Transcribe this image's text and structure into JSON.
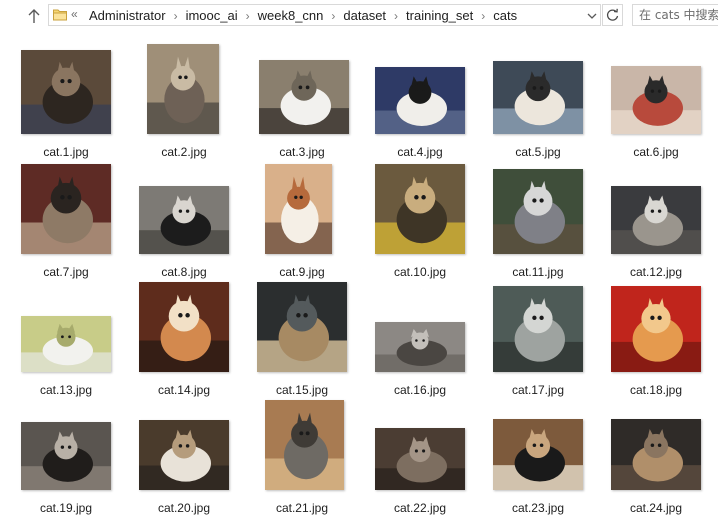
{
  "addressbar": {
    "overflow": "«",
    "breadcrumbs": [
      "Administrator",
      "imooc_ai",
      "week8_cnn",
      "dataset",
      "training_set",
      "cats"
    ],
    "separator": "›"
  },
  "search": {
    "placeholder": "在 cats 中搜索"
  },
  "files": [
    {
      "name": "cat.1.jpg",
      "palette": [
        "#5b4a3a",
        "#2d2620",
        "#8a7560",
        "#3a3f52"
      ]
    },
    {
      "name": "cat.2.jpg",
      "palette": [
        "#9f8f78",
        "#6e6156",
        "#c9bba4",
        "#4f4a43"
      ]
    },
    {
      "name": "cat.3.jpg",
      "palette": [
        "#8a7f6e",
        "#f2f1ee",
        "#6e6659",
        "#3b3631"
      ]
    },
    {
      "name": "cat.4.jpg",
      "palette": [
        "#2e3a66",
        "#f0eeea",
        "#1a1a1a",
        "#5c6b8e"
      ]
    },
    {
      "name": "cat.5.jpg",
      "palette": [
        "#3e4a57",
        "#ece6dc",
        "#2b2b2b",
        "#8fa3b8"
      ]
    },
    {
      "name": "cat.6.jpg",
      "palette": [
        "#c9b6a8",
        "#b84a3c",
        "#2a2a2a",
        "#e8d9cb"
      ]
    },
    {
      "name": "cat.7.jpg",
      "palette": [
        "#5e2b25",
        "#8e7a66",
        "#2a2420",
        "#b59e86"
      ]
    },
    {
      "name": "cat.8.jpg",
      "palette": [
        "#7d7a75",
        "#1c1c1c",
        "#d9d5cf",
        "#4a4844"
      ]
    },
    {
      "name": "cat.9.jpg",
      "palette": [
        "#d9b08a",
        "#f5efe6",
        "#b66a3c",
        "#6e5140"
      ]
    },
    {
      "name": "cat.10.jpg",
      "palette": [
        "#6b5a3e",
        "#3e3526",
        "#c9ad7e",
        "#d3b335"
      ]
    },
    {
      "name": "cat.11.jpg",
      "palette": [
        "#3f4e3a",
        "#7f8087",
        "#d6d6d6",
        "#5e5140"
      ]
    },
    {
      "name": "cat.12.jpg",
      "palette": [
        "#3a3b3e",
        "#9a958d",
        "#d9d7d2",
        "#565450"
      ]
    },
    {
      "name": "cat.13.jpg",
      "palette": [
        "#c8cc88",
        "#f2f2ee",
        "#a7ab6c",
        "#e1e3d6"
      ]
    },
    {
      "name": "cat.14.jpg",
      "palette": [
        "#5e2c1c",
        "#d3894e",
        "#f2e0c6",
        "#2b1b14"
      ]
    },
    {
      "name": "cat.15.jpg",
      "palette": [
        "#2b2e2f",
        "#a78a63",
        "#545a5c",
        "#d8c29b"
      ]
    },
    {
      "name": "cat.16.jpg",
      "palette": [
        "#8c8884",
        "#4a4642",
        "#c3bfba",
        "#6a6661"
      ]
    },
    {
      "name": "cat.17.jpg",
      "palette": [
        "#4e5b57",
        "#9ea3a0",
        "#d4d6d3",
        "#2f3432"
      ]
    },
    {
      "name": "cat.18.jpg",
      "palette": [
        "#c0251c",
        "#e59a4e",
        "#f2c88c",
        "#7a1912"
      ]
    },
    {
      "name": "cat.19.jpg",
      "palette": [
        "#5a5550",
        "#201d1b",
        "#b8b0a6",
        "#8a8178"
      ]
    },
    {
      "name": "cat.20.jpg",
      "palette": [
        "#4a3b2c",
        "#e8e2d8",
        "#b59c7c",
        "#2b2520"
      ]
    },
    {
      "name": "cat.21.jpg",
      "palette": [
        "#a87b52",
        "#6e6a64",
        "#3f3b36",
        "#d9b98a"
      ]
    },
    {
      "name": "cat.22.jpg",
      "palette": [
        "#4b3d33",
        "#7d6e60",
        "#a49587",
        "#2a231e"
      ]
    },
    {
      "name": "cat.23.jpg",
      "palette": [
        "#7d5a3c",
        "#1a1a1a",
        "#c9a67e",
        "#e6dcc9"
      ]
    },
    {
      "name": "cat.24.jpg",
      "palette": [
        "#2f2b28",
        "#b08f6a",
        "#8a7560",
        "#5e4e40"
      ]
    }
  ]
}
